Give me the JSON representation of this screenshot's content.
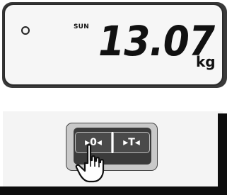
{
  "display": {
    "indicator_icon": "circle-indicator-icon",
    "mode_label": "SUN",
    "reading": "13.07",
    "unit": "kg"
  },
  "keypad": {
    "zero_key_label": "▸0◂",
    "tare_key_label": "▸T◂",
    "pointer_icon": "pointing-hand-icon"
  },
  "colors": {
    "lcd_background": "#f6f6f6",
    "key_background": "#4a4a4a",
    "frame": "#c9c9c9"
  }
}
